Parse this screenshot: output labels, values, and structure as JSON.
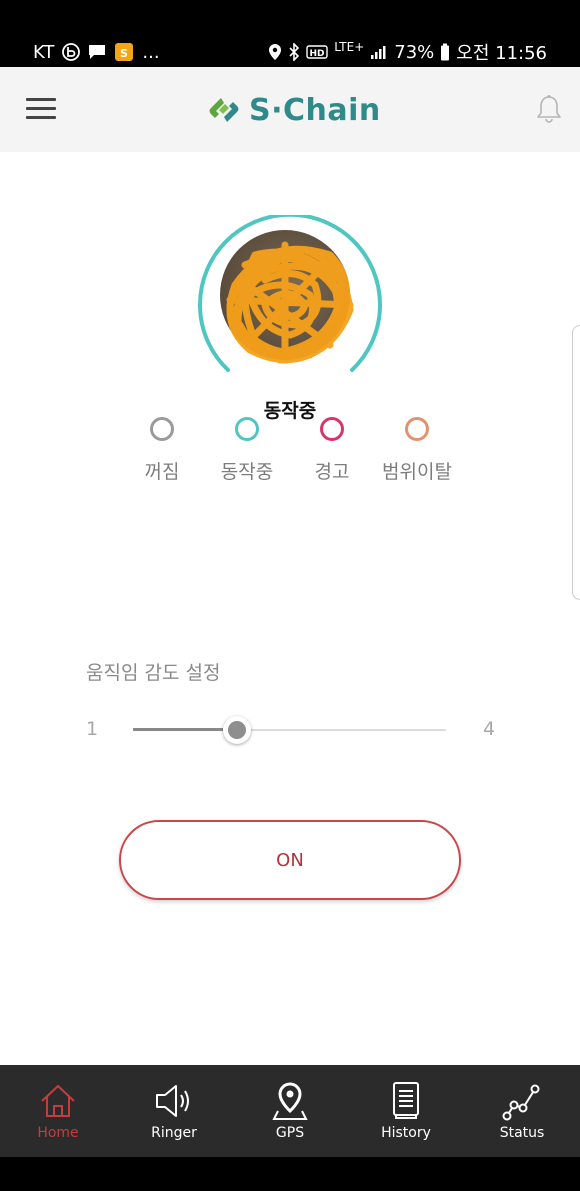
{
  "status_bar": {
    "carrier": "KT",
    "more": "...",
    "lte": "LTE",
    "lte_plus": "+",
    "battery": "73%",
    "time": "오전 11:56"
  },
  "header": {
    "brand": "S·Chain"
  },
  "device": {
    "status_text": "동작중"
  },
  "legend": [
    {
      "label": "꺼짐",
      "color": "#9a9a9a"
    },
    {
      "label": "동작중",
      "color": "#4fc6c2"
    },
    {
      "label": "경고",
      "color": "#d9356a"
    },
    {
      "label": "범위이탈",
      "color": "#e29270"
    }
  ],
  "sensitivity": {
    "title": "움직임 감도 설정",
    "min_label": "1",
    "max_label": "4",
    "min": 1,
    "max": 4,
    "value": 2
  },
  "power_button": {
    "label": "ON"
  },
  "bottom_nav": {
    "items": [
      {
        "label": "Home",
        "icon": "home-icon",
        "active": true
      },
      {
        "label": "Ringer",
        "icon": "speaker-icon",
        "active": false
      },
      {
        "label": "GPS",
        "icon": "map-pin-icon",
        "active": false
      },
      {
        "label": "History",
        "icon": "document-icon",
        "active": false
      },
      {
        "label": "Status",
        "icon": "line-graph-icon",
        "active": false
      }
    ]
  },
  "colors": {
    "accent_teal": "#4fc6c2",
    "brand_green": "#5aa83c",
    "brand_teal": "#2f8a89",
    "on_red": "#c8474b",
    "nav_active": "#c43c3c",
    "nav_bg": "#2b2b2b"
  }
}
